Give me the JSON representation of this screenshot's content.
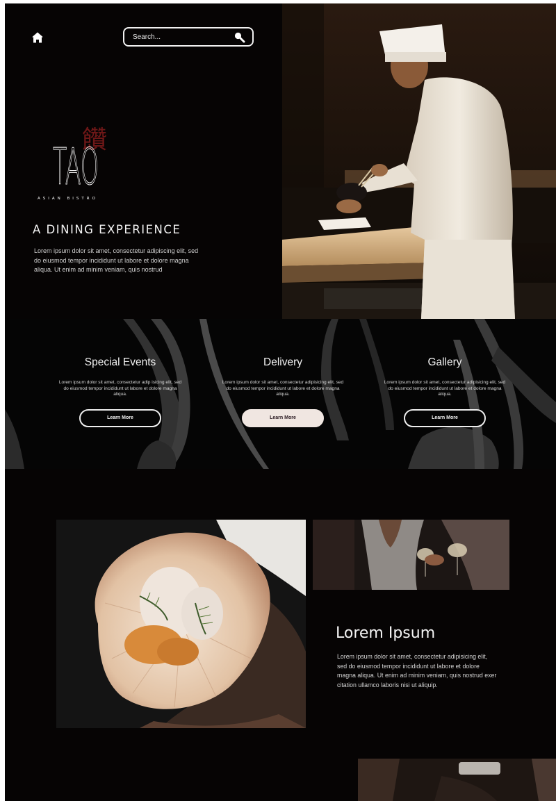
{
  "header": {
    "home_icon": "home-icon",
    "search_placeholder": "Search...",
    "search_icon": "search-icon"
  },
  "brand": {
    "name": "TAO",
    "tagline": "ASIAN BISTRO",
    "kanji": "饡",
    "kanji_color": "#8b1c1c"
  },
  "hero": {
    "title": "A DINING EXPERIENCE",
    "text": "Lorem ipsum dolor sit amet, consectetur adipiscing elit, sed do eiusmod tempor incididunt ut labore et dolore magna aliqua. Ut enim ad minim veniam, quis nostrud"
  },
  "features": [
    {
      "title": "Special Events",
      "text": "Lorem ipsum dolor sit amet, consectetur adip isicing elit, sed do eiusmod tempor incididunt ut labore et dolore magna aliqua.",
      "button": "Learn More"
    },
    {
      "title": "Delivery",
      "text": "Lorem ipsum dolor sit amet, consectetur adipisicing elit, sed do eiusmod tempor incididunt ut labore et dolore magna aliqua.",
      "button": "Learn More"
    },
    {
      "title": "Gallery",
      "text": "Lorem ipsum dolor sit amet, consectetur adipisicing elit, sed do eiusmod tempor incididunt ut labore et dolore magna aliqua.",
      "button": "Learn More"
    }
  ],
  "section": {
    "title": "Lorem Ipsum",
    "text": "Lorem ipsum dolor sit amet, consectetur adipisicing elit, sed do eiusmod tempor incididunt ut labore et dolore magna aliqua. Ut enim ad minim veniam, quis nostrud exer citation ullamco laboris nisi ut aliquip."
  },
  "colors": {
    "background": "#060404",
    "accent_button": "#f0e6e1",
    "text": "#f4f4f4"
  }
}
